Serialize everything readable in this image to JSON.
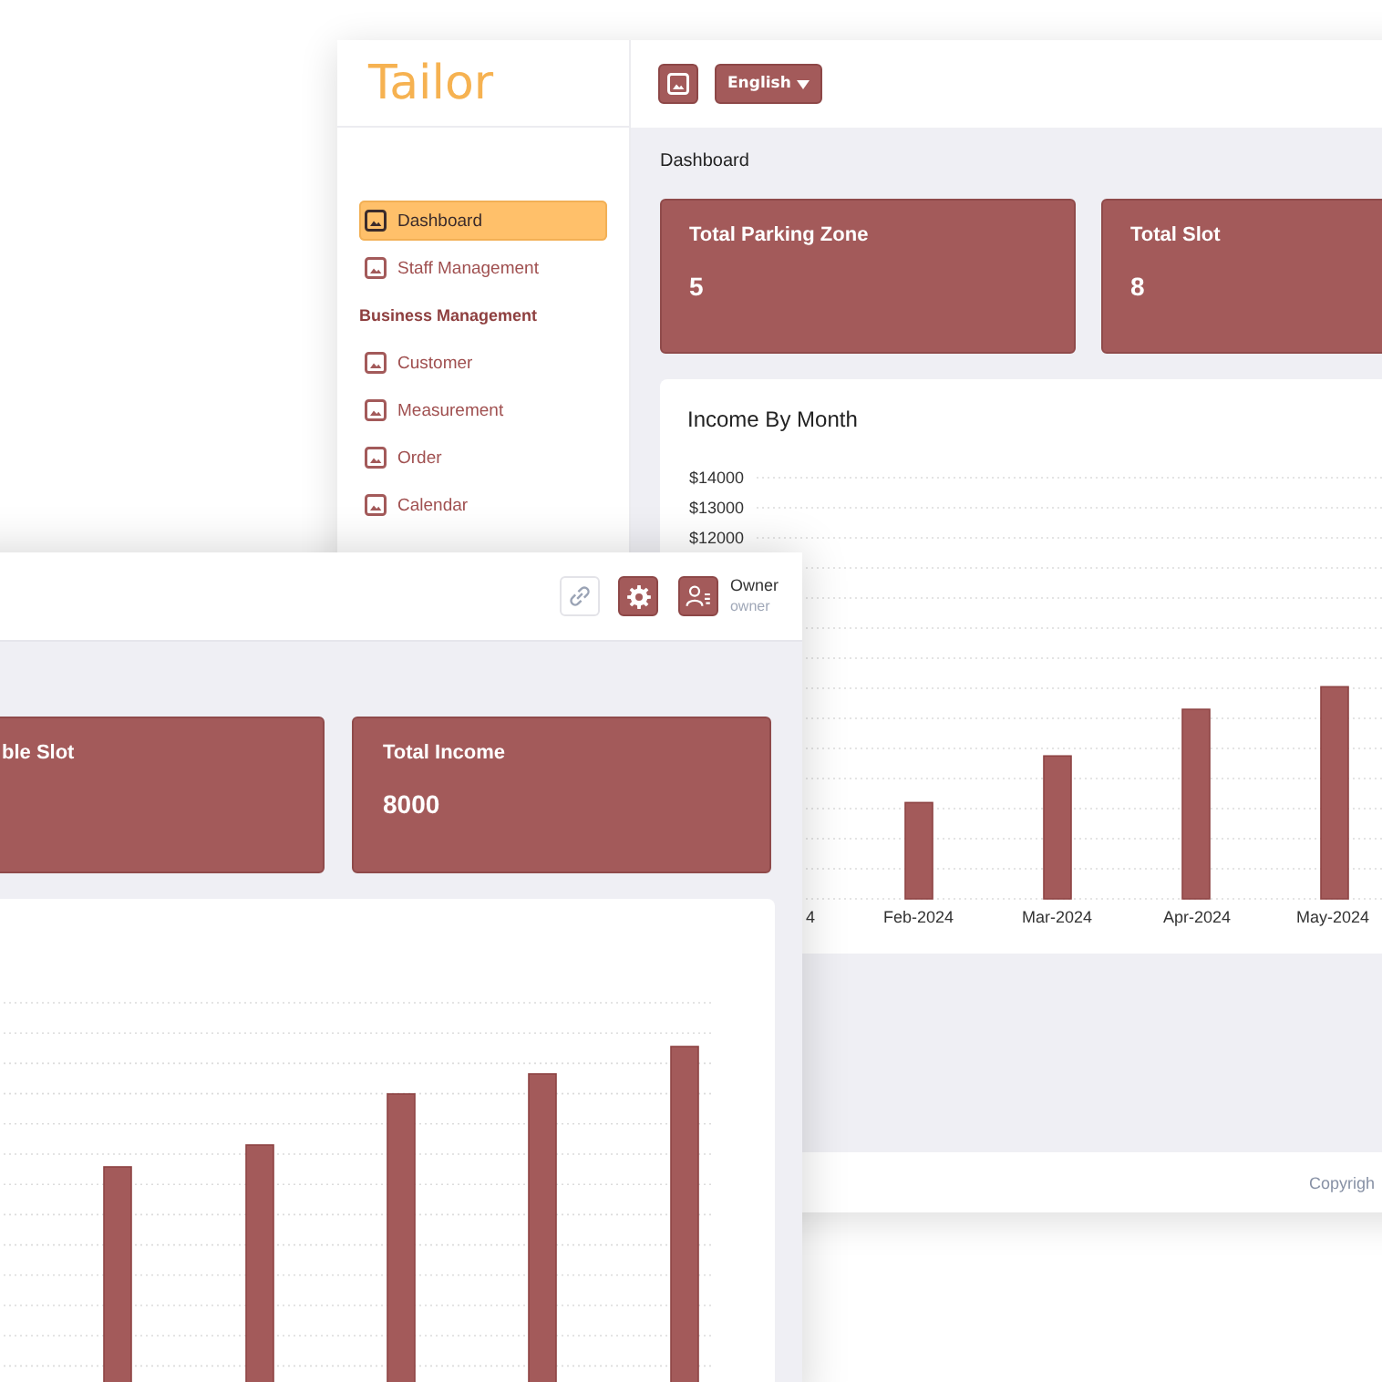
{
  "back_window": {
    "sidebar": {
      "logo": "Tailor",
      "items": [
        {
          "label": "Dashboard",
          "selected": true
        },
        {
          "label": "Staff Management",
          "selected": false
        }
      ],
      "sections": [
        {
          "title": "Business Management",
          "items": [
            {
              "label": "Customer",
              "selected": false
            },
            {
              "label": "Measurement",
              "selected": false
            },
            {
              "label": "Order",
              "selected": false
            },
            {
              "label": "Calendar",
              "selected": false
            }
          ]
        }
      ]
    },
    "top_bar": {
      "language": "English"
    },
    "breadcrumb": "Dashboard",
    "stat_cards": [
      {
        "title": "Total Parking Zone",
        "value": "5"
      },
      {
        "title": "Total Slot",
        "value": "8"
      }
    ],
    "income_chart": {
      "chart_data": {
        "type": "bar",
        "title": "Income By Month",
        "categories": [
          "4",
          "Feb-2024",
          "Mar-2024",
          "Apr-2024",
          "May-2024"
        ],
        "values": [
          null,
          3200,
          4750,
          6300,
          7050
        ],
        "ylim": [
          0,
          14000
        ],
        "yticks": [
          {
            "value": 14000,
            "label": "$14000"
          },
          {
            "value": 13000,
            "label": "$13000"
          },
          {
            "value": 12000,
            "label": "$12000"
          }
        ]
      }
    },
    "footer": {
      "text": "Copyrigh"
    }
  },
  "front_window": {
    "top_bar": {
      "user_name": "Owner",
      "user_role": "owner"
    },
    "stat_cards": [
      {
        "title": "ble Slot"
      },
      {
        "title": "Total Income",
        "value": "8000"
      }
    ]
  }
}
